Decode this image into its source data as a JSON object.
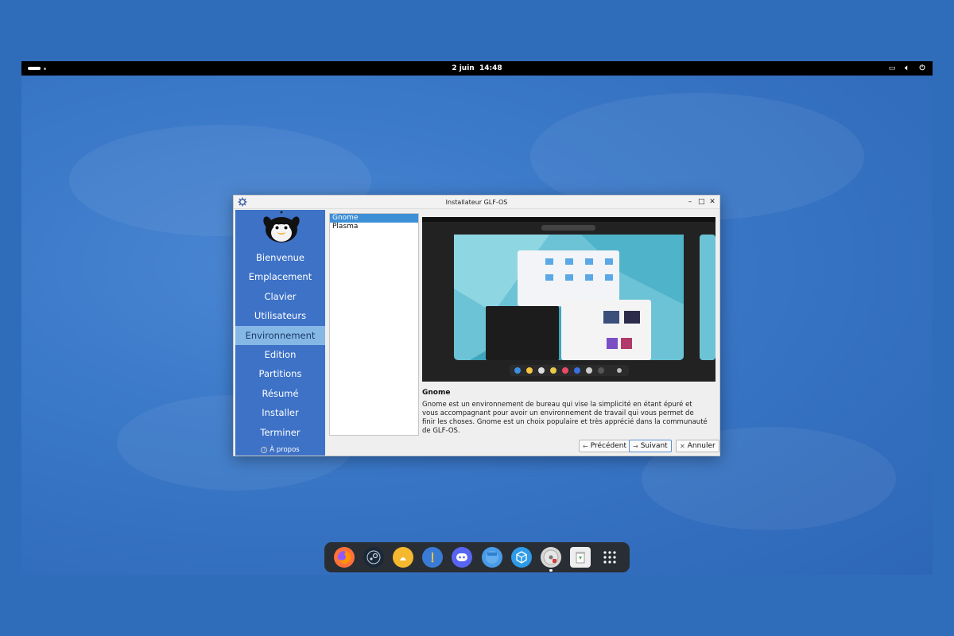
{
  "topbar": {
    "date": "2 juin",
    "time": "14:48"
  },
  "window": {
    "title": "Installateur GLF-OS"
  },
  "sidebar": {
    "items": [
      {
        "label": "Bienvenue"
      },
      {
        "label": "Emplacement"
      },
      {
        "label": "Clavier"
      },
      {
        "label": "Utilisateurs"
      },
      {
        "label": "Environnement"
      },
      {
        "label": "Edition"
      },
      {
        "label": "Partitions"
      },
      {
        "label": "Résumé"
      },
      {
        "label": "Installer"
      },
      {
        "label": "Terminer"
      }
    ],
    "active_index": 4,
    "about_label": "À propos"
  },
  "environments": {
    "items": [
      {
        "label": "Gnome"
      },
      {
        "label": "Plasma"
      }
    ],
    "selected_index": 0
  },
  "description": {
    "title": "Gnome",
    "text": "Gnome est un environnement de bureau qui vise la simplicité en étant épuré et vous accompagnant pour avoir un environnement de travail qui vous permet de finir les choses. Gnome est un choix populaire et très apprécié dans la communauté de GLF-OS."
  },
  "buttons": {
    "previous": "Précédent",
    "next": "Suivant",
    "cancel": "Annuler"
  },
  "dock": {
    "apps": [
      {
        "name": "firefox-icon",
        "color": "#ff7139"
      },
      {
        "name": "steam-icon",
        "color": "#1b2838"
      },
      {
        "name": "lutris-icon",
        "color": "#f5b82e"
      },
      {
        "name": "heroic-icon",
        "color": "#3a7bd5"
      },
      {
        "name": "discord-icon",
        "color": "#5865f2"
      },
      {
        "name": "files-icon",
        "color": "#4a9be8"
      },
      {
        "name": "protonup-icon",
        "color": "#2f9be8"
      },
      {
        "name": "installer-disc-icon",
        "color": "#d8d8d8"
      },
      {
        "name": "trash-icon",
        "color": "#eeeeee"
      },
      {
        "name": "app-grid-icon",
        "color": "#ffffff"
      }
    ]
  },
  "colors": {
    "sidebar_bg": "#3d72c7",
    "sidebar_active": "#86b8e6",
    "selection": "#3d8fd6",
    "desktop_bg": "#3a78c8"
  }
}
